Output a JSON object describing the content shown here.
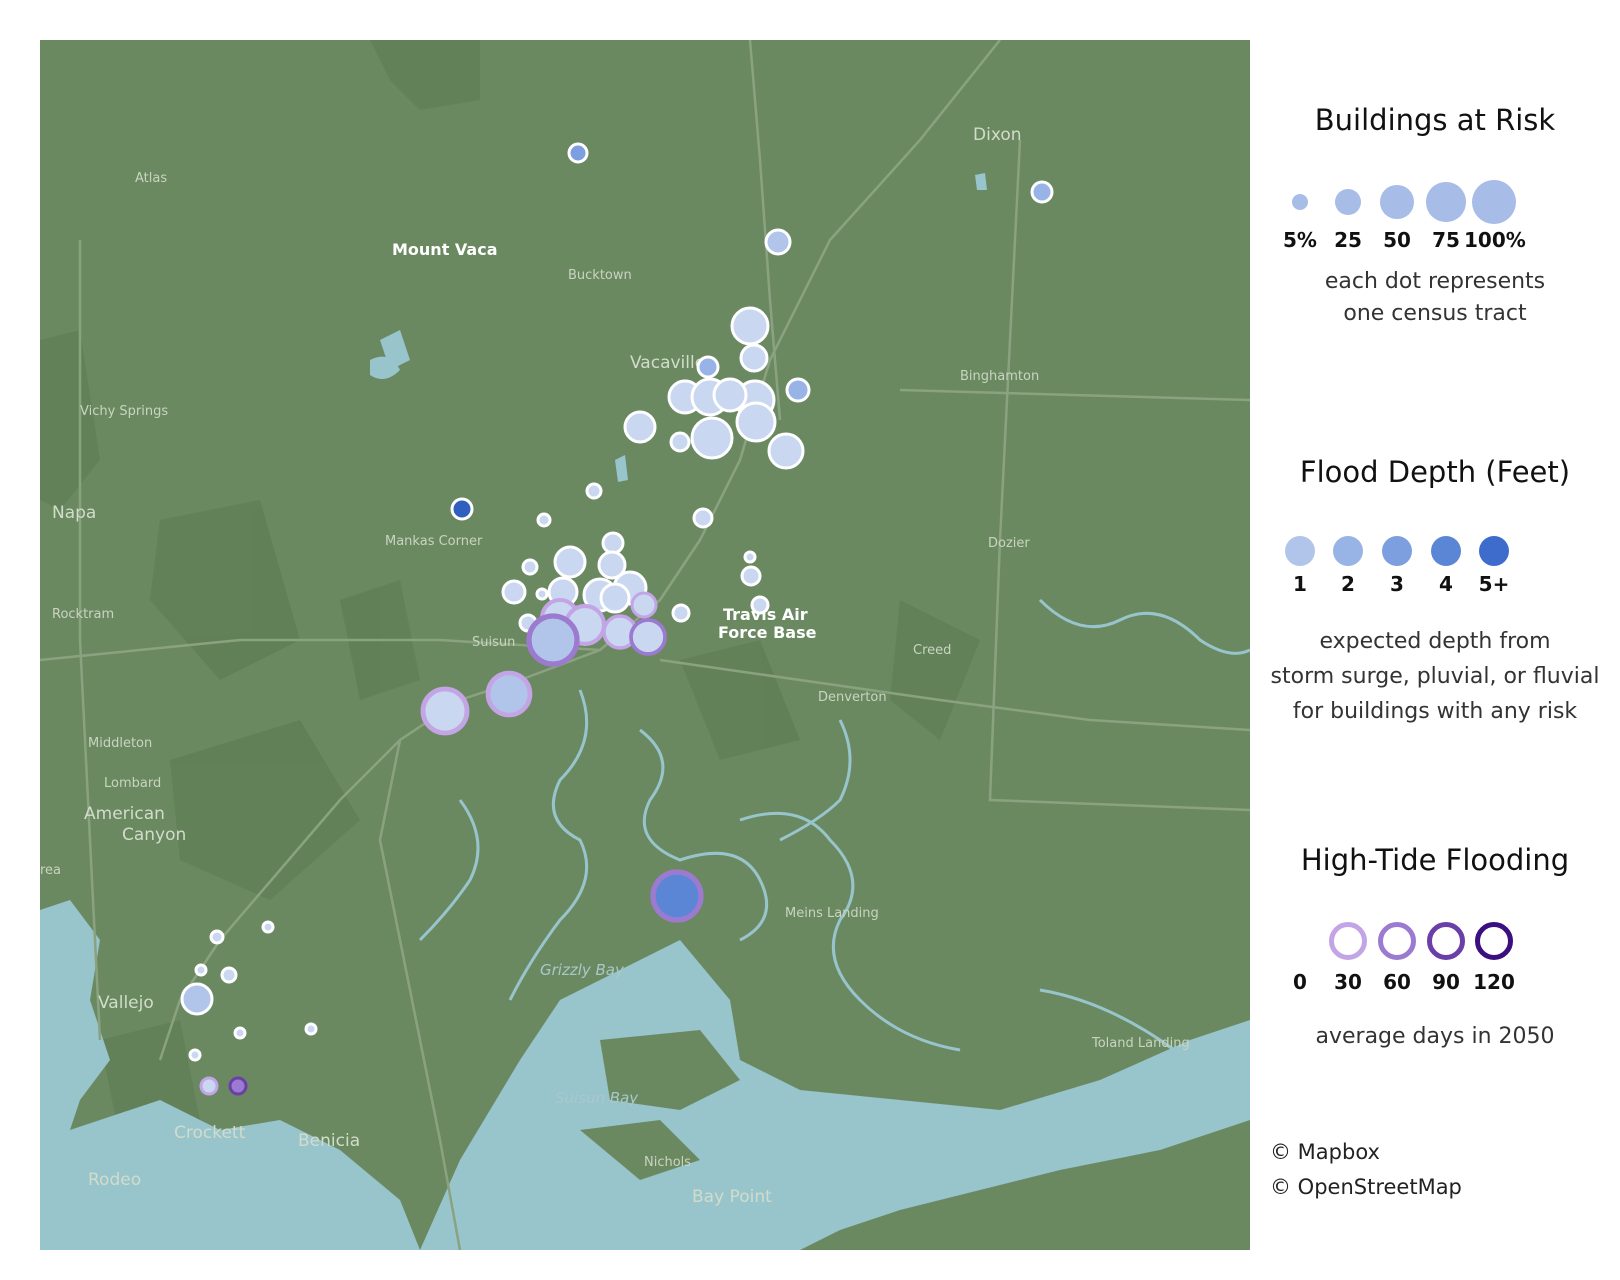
{
  "map": {
    "places": [
      "Atlas",
      "Mount Vaca",
      "Bucktown",
      "Vacaville",
      "Dixon",
      "Binghamton",
      "Vichy Springs",
      "Napa",
      "Mankas Corner",
      "Dozier",
      "Rocktram",
      "Suisun",
      "Travis Air",
      "Force Base",
      "Creed",
      "Denverton",
      "Middleton",
      "Lombard",
      "American",
      "Canyon",
      "Meins Landing",
      "Grizzly Bay",
      "Vallejo",
      "Suisun Bay",
      "Crockett",
      "Benicia",
      "Nichols",
      "Rodeo",
      "Bay Point",
      "Toland Landing",
      "rea"
    ],
    "colors": {
      "land": "#6b8961",
      "water": "#98c4cc",
      "road": "#8aa280",
      "park": "#5e7d55",
      "dot_fill": "#c9d7f0",
      "dot_stroke": "#ffffff"
    }
  },
  "legend": {
    "buildings": {
      "title": "Buildings at Risk",
      "items": [
        {
          "label": "5%",
          "size": 5
        },
        {
          "label": "25",
          "size": 25
        },
        {
          "label": "50",
          "size": 50
        },
        {
          "label": "75",
          "size": 75
        },
        {
          "label": "100%",
          "size": 100
        }
      ],
      "desc_line1": "each dot represents",
      "desc_line2": "one census tract"
    },
    "depth": {
      "title": "Flood Depth (Feet)",
      "items": [
        {
          "label": "1",
          "color": "#b1c5ea"
        },
        {
          "label": "2",
          "color": "#98b3e6"
        },
        {
          "label": "3",
          "color": "#7d9fe0"
        },
        {
          "label": "4",
          "color": "#5b86d6"
        },
        {
          "label": "5+",
          "color": "#3e6ccc"
        }
      ],
      "desc_line1": "expected depth from",
      "desc_line2": "storm surge, pluvial, or fluvial",
      "desc_line3": "for buildings with any risk"
    },
    "tide": {
      "title": "High-Tide Flooding",
      "items": [
        {
          "label": "0",
          "color": "none"
        },
        {
          "label": "30",
          "color": "#c3a5e6"
        },
        {
          "label": "60",
          "color": "#9c7ad0"
        },
        {
          "label": "90",
          "color": "#6a3fa8"
        },
        {
          "label": "120",
          "color": "#3c0f80"
        }
      ],
      "desc": "average days in 2050"
    }
  },
  "credits": {
    "mapbox": "© Mapbox",
    "osm": "© OpenStreetMap"
  }
}
